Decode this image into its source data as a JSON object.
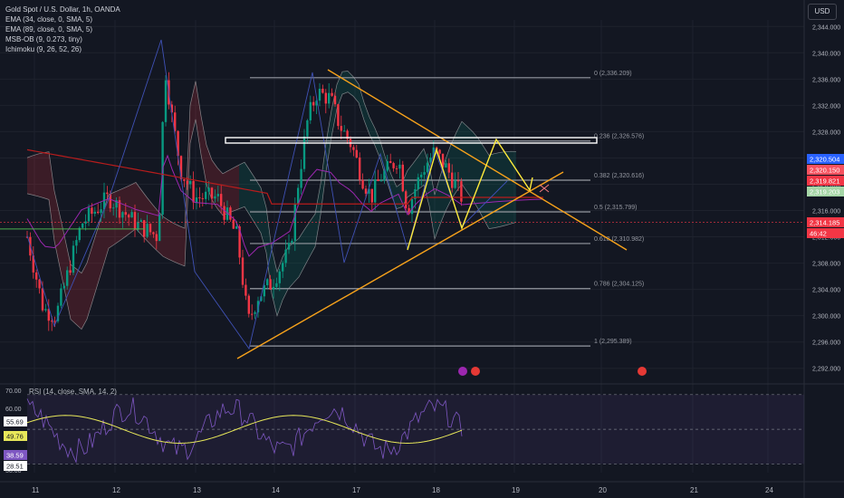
{
  "header": {
    "title": "Gold Spot / U.S. Dollar, 1h, OANDA",
    "indicators": [
      "EMA (34, close, 0, SMA, 5)",
      "EMA (89, close, 0, SMA, 5)",
      "MSB-OB (9, 0.273, tiny)",
      "Ichimoku (9, 26, 52, 26)"
    ],
    "currency": "USD"
  },
  "rsi": {
    "label": "RSI (14, close, SMA, 14, 2)",
    "levels": [
      "70.00",
      "60.00",
      "30.00"
    ],
    "badges": [
      {
        "text": "55.69",
        "bg": "#ffffff",
        "fg": "#131722"
      },
      {
        "text": "49.76",
        "bg": "#e8e85a",
        "fg": "#131722"
      },
      {
        "text": "38.59",
        "bg": "#7e57c2",
        "fg": "#ffffff"
      },
      {
        "text": "28.51",
        "bg": "#ffffff",
        "fg": "#131722"
      }
    ]
  },
  "price_labels": [
    {
      "text": "2,320.504",
      "bg": "#2962ff"
    },
    {
      "text": "2,320.150",
      "bg": "#f7525f"
    },
    {
      "text": "2,319.821",
      "bg": "#f23645"
    },
    {
      "text": "2,319.203",
      "bg": "#a5d6a7"
    },
    {
      "text": "2,314.185",
      "bg": "#f23645"
    },
    {
      "text": "46:42",
      "bg": "#f23645"
    }
  ],
  "colors": {
    "bull": "#089981",
    "bear": "#f23645",
    "accent_orange": "#f7a21b",
    "yellow": "#ffeb3b",
    "fib": "#9598a1"
  },
  "chart_data": {
    "type": "candlestick",
    "title": "Gold Spot / U.S. Dollar, 1h, OANDA",
    "x_ticks": [
      "11",
      "12",
      "13",
      "14",
      "17",
      "18",
      "19",
      "20",
      "21",
      "24"
    ],
    "y_ticks": [
      "2,344.000",
      "2,340.000",
      "2,336.000",
      "2,332.000",
      "2,328.000",
      "2,324.000",
      "2,320.000",
      "2,316.000",
      "2,312.000",
      "2,308.000",
      "2,304.000",
      "2,300.000",
      "2,296.000",
      "2,292.000"
    ],
    "ylim": [
      2291,
      2345
    ],
    "fib_levels": [
      {
        "label": "0 (2,336.209)",
        "value": 2336.209
      },
      {
        "label": "0.236 (2,326.576)",
        "value": 2326.576
      },
      {
        "label": "0.382 (2,320.616)",
        "value": 2320.616
      },
      {
        "label": "0.5 (2,315.799)",
        "value": 2315.799
      },
      {
        "label": "0.618 (2,310.982)",
        "value": 2310.982
      },
      {
        "label": "0.786 (2,304.125)",
        "value": 2304.125
      },
      {
        "label": "1 (2,295.389)",
        "value": 2295.389
      }
    ],
    "last_price": 2314.185,
    "rsi_range": [
      25,
      72
    ]
  }
}
